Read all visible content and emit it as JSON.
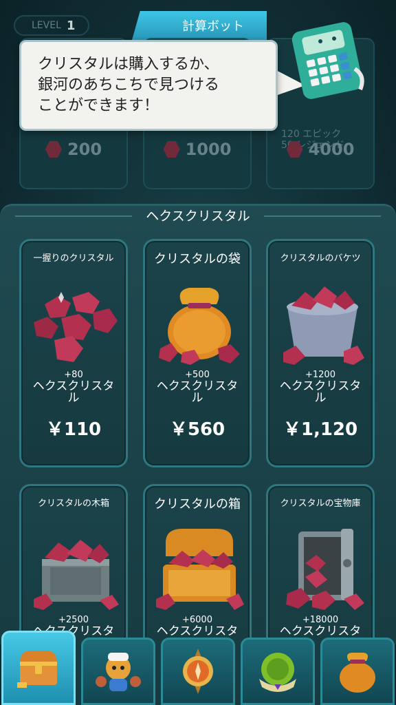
{
  "header": {
    "level_label": "LEVEL",
    "level_value": "1",
    "active_tab": "計算ボット"
  },
  "speech_bubble": {
    "lines": [
      "クリスタルは購入するか、",
      "銀河のあちこちで見つける",
      "ことができます！"
    ]
  },
  "top_cards": [
    {
      "price": "200"
    },
    {
      "price": "1000"
    },
    {
      "price": "4000",
      "rarity_lines": [
        "120 エピック",
        "50 レジェンド"
      ]
    }
  ],
  "section": {
    "title": "ヘクスクリスタル"
  },
  "items": [
    {
      "name": "一握りのクリスタル",
      "amount": "+80",
      "unit": "ヘクスクリスタル",
      "price": "￥110",
      "icon": "crystal-handful-icon"
    },
    {
      "name": "クリスタルの袋",
      "amount": "+500",
      "unit": "ヘクスクリスタル",
      "price": "￥560",
      "icon": "crystal-bag-icon"
    },
    {
      "name": "クリスタルのバケツ",
      "amount": "+1200",
      "unit": "ヘクスクリスタル",
      "price": "￥1,120",
      "icon": "crystal-bucket-icon"
    },
    {
      "name": "クリスタルの木箱",
      "amount": "+2500",
      "unit": "ヘクスクリスタ",
      "price": "",
      "icon": "crystal-crate-icon"
    },
    {
      "name": "クリスタルの箱",
      "amount": "+6000",
      "unit": "ヘクスクリスタ",
      "price": "",
      "icon": "crystal-chest-icon"
    },
    {
      "name": "クリスタルの宝物庫",
      "amount": "+18000",
      "unit": "ヘクスクリスタ",
      "price": "",
      "icon": "crystal-vault-icon"
    }
  ],
  "bottom_nav": [
    {
      "icon": "treasure-chest-icon",
      "active": true
    },
    {
      "icon": "character-icon",
      "active": false
    },
    {
      "icon": "compass-icon",
      "active": false
    },
    {
      "icon": "planet-icon",
      "active": false
    },
    {
      "icon": "gem-bag-icon",
      "active": false
    }
  ],
  "colors": {
    "accent": "#3ec6e6",
    "gem": "#b3304f",
    "gold": "#e5a22a"
  }
}
